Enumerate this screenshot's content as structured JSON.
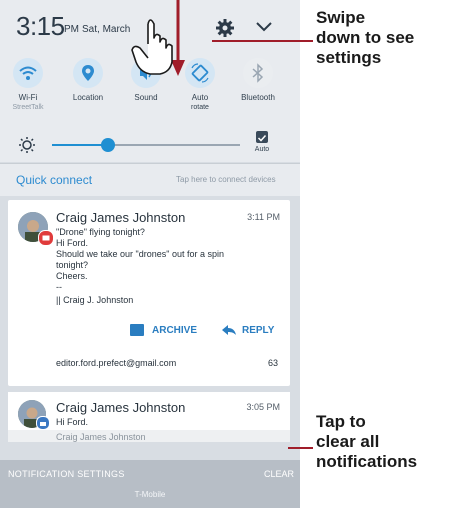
{
  "status": {
    "time": "3:15",
    "ampm": "PM",
    "date": "Sat, March"
  },
  "toggles": [
    {
      "label": "Wi-Fi",
      "sub": "StreetTalk",
      "icon": "wifi-icon"
    },
    {
      "label": "Location",
      "sub": "",
      "icon": "location-icon"
    },
    {
      "label": "Sound",
      "sub": "",
      "icon": "sound-icon"
    },
    {
      "label": "Auto",
      "sub": "rotate",
      "icon": "auto-rotate-icon"
    },
    {
      "label": "Bluetooth",
      "sub": "",
      "icon": "bluetooth-icon"
    }
  ],
  "brightness": {
    "level": 0.3,
    "auto_label": "Auto"
  },
  "quick_connect": {
    "title": "Quick connect",
    "hint": "Tap here to connect devices"
  },
  "notification": {
    "sender": "Craig James Johnston",
    "time": "3:11 PM",
    "lines": [
      "\"Drone\" flying tonight?",
      "Hi Ford.",
      "Should we take our \"drones\" out for a spin",
      "tonight?",
      "Cheers.",
      "--",
      "|| Craig J. Johnston"
    ],
    "archive_label": "ARCHIVE",
    "reply_label": "REPLY",
    "account": "editor.ford.prefect@gmail.com",
    "count": "63"
  },
  "notification2": {
    "sender": "Craig James Johnston",
    "time": "3:05 PM",
    "sub": "Hi Ford."
  },
  "notification3": {
    "ghost": "Craig James Johnston"
  },
  "bottom": {
    "settings_label": "NOTIFICATION SETTINGS",
    "clear_label": "CLEAR",
    "carrier": "T-Mobile"
  },
  "callouts": {
    "swipe": [
      "Swipe",
      "down to see",
      "settings"
    ],
    "tap": [
      "Tap to",
      "clear all",
      "notifications"
    ]
  },
  "colors": {
    "accent": "#2a7dc0",
    "callout_line": "#a01d2a"
  }
}
